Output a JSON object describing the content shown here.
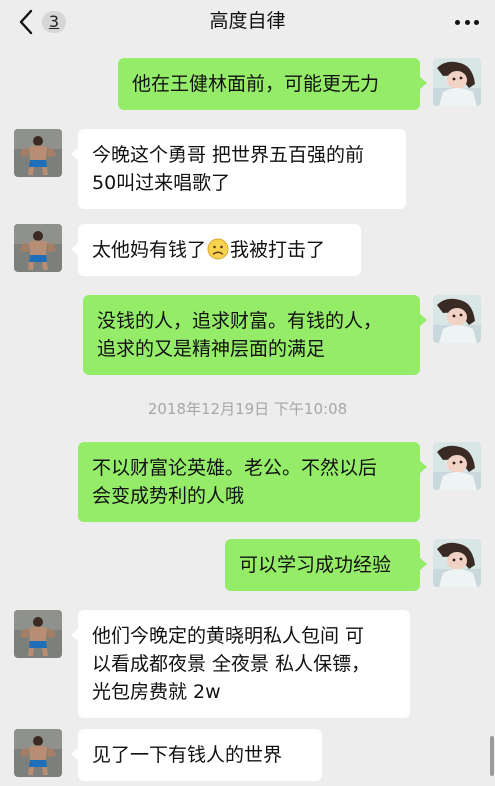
{
  "header": {
    "title": "高度自律",
    "unread_count": "3",
    "back_icon": "chevron-left-icon",
    "more_icon": "ellipsis-icon"
  },
  "timestamp": "2018年12月19日 下午10:08",
  "colors": {
    "background": "#ededed",
    "outgoing_bubble": "#95ec69",
    "incoming_bubble": "#ffffff"
  },
  "messages": [
    {
      "side": "right",
      "text": "他在王健林面前，可能更无力"
    },
    {
      "side": "left",
      "lines": [
        "今晚这个勇哥 把世界五百强的前",
        "50叫过来唱歌了"
      ]
    },
    {
      "side": "left",
      "before_emoji": "太他妈有钱了",
      "emoji": "sad-face-emoji",
      "after_emoji": "我被打击了"
    },
    {
      "side": "right",
      "lines": [
        "没钱的人，追求财富。有钱的人，",
        "追求的又是精神层面的满足"
      ]
    },
    {
      "side": "right",
      "lines": [
        "不以财富论英雄。老公。不然以后",
        "会变成势利的人哦"
      ]
    },
    {
      "side": "right",
      "text": "可以学习成功经验"
    },
    {
      "side": "left",
      "lines": [
        "他们今晚定的黄晓明私人包间 可",
        "以看成都夜景 全夜景 私人保镖，",
        "光包房费就 2w"
      ]
    },
    {
      "side": "left",
      "text": "见了一下有钱人的世界"
    }
  ]
}
